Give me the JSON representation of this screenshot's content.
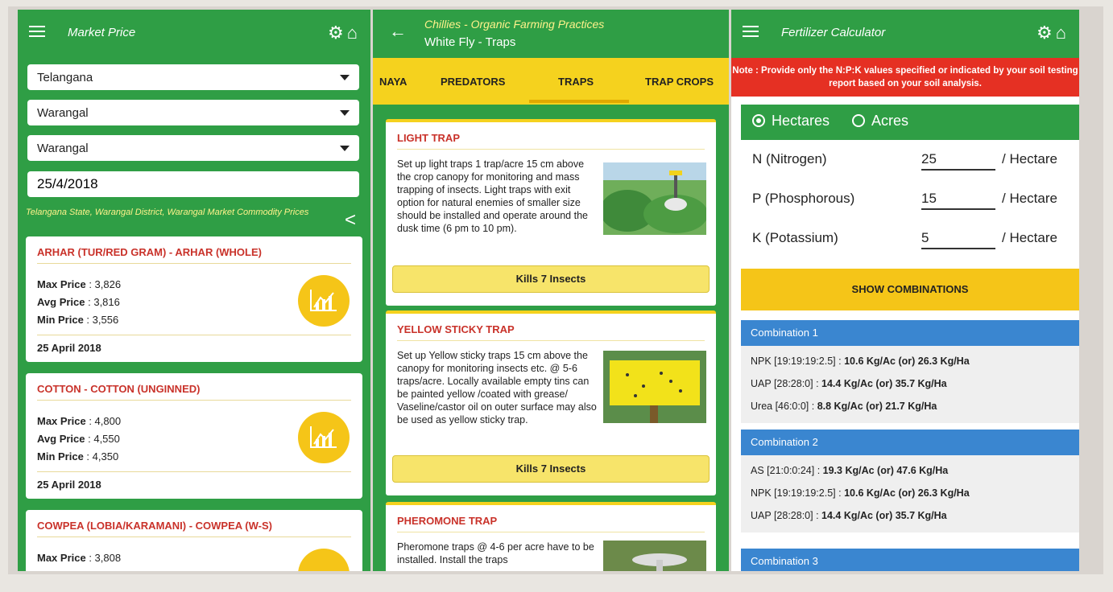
{
  "colors": {
    "green": "#2f9e45",
    "yellow": "#f5d21e",
    "red": "#e53023",
    "blue": "#3a86d0",
    "title_red": "#c9322a"
  },
  "market": {
    "title": "Market Price",
    "icons": [
      "gear-icon",
      "home-icon"
    ],
    "state": "Telangana",
    "district": "Warangal",
    "market": "Warangal",
    "date": "25/4/2018",
    "info": "Telangana State, Warangal District, Warangal Market Commodity Prices",
    "cards": [
      {
        "title": "ARHAR (TUR/RED GRAM) - ARHAR (WHOLE)",
        "max_label": "Max Price",
        "max": "3,826",
        "avg_label": "Avg Price",
        "avg": "3,816",
        "min_label": "Min Price",
        "min": "3,556",
        "date": "25 April 2018"
      },
      {
        "title": "COTTON - COTTON (UNGINNED)",
        "max_label": "Max Price",
        "max": "4,800",
        "avg_label": "Avg Price",
        "avg": "4,550",
        "min_label": "Min Price",
        "min": "4,350",
        "date": "25 April 2018"
      },
      {
        "title": "COWPEA (LOBIA/KARAMANI) - COWPEA (W-S)",
        "max_label": "Max Price",
        "max": "3,808"
      }
    ]
  },
  "traps": {
    "title": "Chillies - Organic Farming Practices",
    "subtitle": "White Fly - Traps",
    "tabs": [
      "NAYA",
      "PREDATORS",
      "TRAPS",
      "TRAP CROPS"
    ],
    "active_tab": "TRAPS",
    "cards": [
      {
        "title": "LIGHT TRAP",
        "desc": "Set up light traps 1 trap/acre 15 cm above the crop canopy for monitoring and mass trapping of insects. Light traps with exit option for natural enemies of smaller size should be installed and operate around the dusk time (6 pm to 10 pm).",
        "button": "Kills 7 Insects"
      },
      {
        "title": "YELLOW STICKY TRAP",
        "desc": "Set up Yellow sticky traps 15 cm above the canopy for monitoring insects etc. @ 5-6 traps/acre. Locally available empty tins can be painted yellow /coated with grease/ Vaseline/castor oil on outer surface may also be used as yellow sticky trap.",
        "button": "Kills 7 Insects"
      },
      {
        "title": "PHEROMONE TRAP",
        "desc": "Pheromone traps @ 4-6 per acre have to be installed. Install the traps"
      }
    ]
  },
  "fert": {
    "title": "Fertilizer Calculator",
    "icons": [
      "gear-icon",
      "home-icon"
    ],
    "note": "Note : Provide only the N:P:K values specified or indicated by your soil testing report based on your soil analysis.",
    "unit_options": [
      "Hectares",
      "Acres"
    ],
    "selected_unit": "Hectares",
    "inputs": [
      {
        "label": "N (Nitrogen)",
        "value": "25",
        "unit": "/ Hectare"
      },
      {
        "label": "P (Phosphorous)",
        "value": "15",
        "unit": "/ Hectare"
      },
      {
        "label": "K (Potassium)",
        "value": "5",
        "unit": "/ Hectare"
      }
    ],
    "show_button": "SHOW COMBINATIONS",
    "combinations": [
      {
        "name": "Combination 1",
        "lines": [
          {
            "k": "NPK [19:19:19:2.5]",
            "v": "10.6 Kg/Ac (or) 26.3 Kg/Ha"
          },
          {
            "k": "UAP [28:28:0]",
            "v": "14.4 Kg/Ac (or) 35.7 Kg/Ha"
          },
          {
            "k": "Urea [46:0:0]",
            "v": "8.8 Kg/Ac (or) 21.7 Kg/Ha"
          }
        ]
      },
      {
        "name": "Combination 2",
        "lines": [
          {
            "k": "AS [21:0:0:24]",
            "v": "19.3 Kg/Ac (or) 47.6 Kg/Ha"
          },
          {
            "k": "NPK [19:19:19:2.5]",
            "v": "10.6 Kg/Ac (or) 26.3 Kg/Ha"
          },
          {
            "k": "UAP [28:28:0]",
            "v": "14.4 Kg/Ac (or) 35.7 Kg/Ha"
          }
        ]
      },
      {
        "name": "Combination 3"
      }
    ]
  }
}
